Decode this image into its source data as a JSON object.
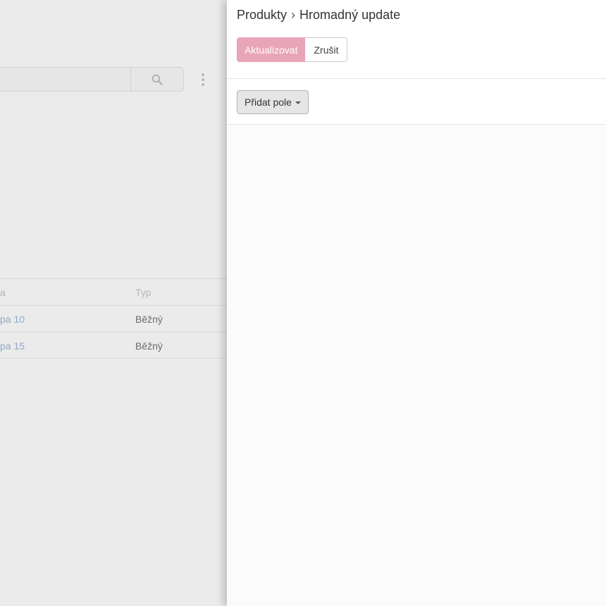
{
  "background": {
    "table": {
      "header": {
        "col_a": "a",
        "col_b": "Typ"
      },
      "rows": [
        {
          "col_a": "pa 10",
          "col_b": "Běžný"
        },
        {
          "col_a": "pa 15",
          "col_b": "Běžný"
        }
      ]
    }
  },
  "panel": {
    "breadcrumb": {
      "parent": "Produkty",
      "separator": "›",
      "current": "Hromadný update"
    },
    "actions": {
      "update_label": "Aktualizovat",
      "cancel_label": "Zrušit"
    },
    "toolbar": {
      "add_field_label": "Přidat pole"
    }
  },
  "colors": {
    "primary_button": "#e8a5b8",
    "link": "#92a8c6",
    "backdrop": "#ebebeb"
  },
  "icons": {
    "search": "search-icon",
    "more": "more-vertical-icon",
    "caret": "caret-down-icon"
  }
}
